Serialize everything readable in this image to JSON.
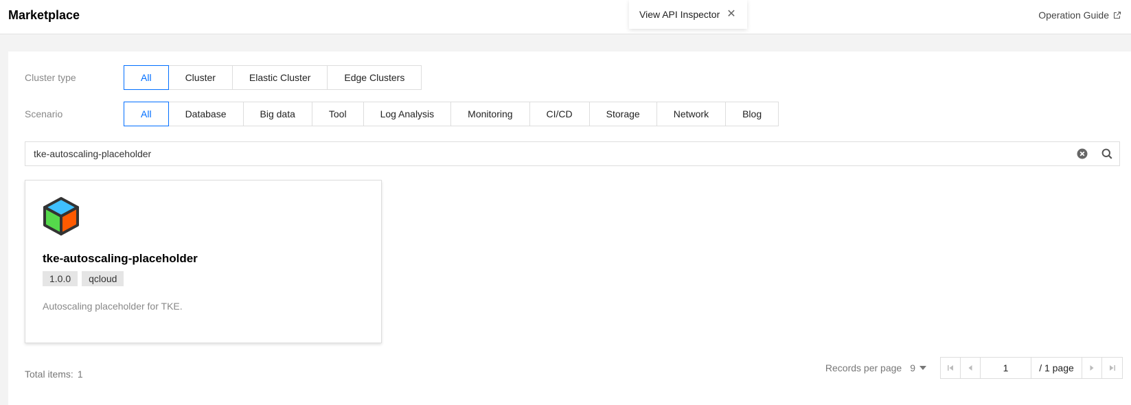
{
  "header": {
    "title": "Marketplace",
    "operation_guide": "Operation Guide"
  },
  "api_inspector": {
    "label": "View API Inspector"
  },
  "filters": {
    "cluster_type": {
      "label": "Cluster type",
      "options": [
        "All",
        "Cluster",
        "Elastic Cluster",
        "Edge Clusters"
      ],
      "selected": "All"
    },
    "scenario": {
      "label": "Scenario",
      "options": [
        "All",
        "Database",
        "Big data",
        "Tool",
        "Log Analysis",
        "Monitoring",
        "CI/CD",
        "Storage",
        "Network",
        "Blog"
      ],
      "selected": "All"
    }
  },
  "search": {
    "value": "tke-autoscaling-placeholder",
    "placeholder": ""
  },
  "cards": [
    {
      "name": "tke-autoscaling-placeholder",
      "tags": [
        "1.0.0",
        "qcloud"
      ],
      "description": "Autoscaling placeholder for TKE."
    }
  ],
  "footer": {
    "total_label": "Total items:",
    "total_value": "1",
    "records_per_page_label": "Records per page",
    "records_per_page_value": "9",
    "current_page": "1",
    "total_pages": "/ 1 page"
  },
  "colors": {
    "accent": "#006eff",
    "cube_top": "#3fc0ff",
    "cube_left": "#55d94b",
    "cube_right": "#ff5a00"
  }
}
